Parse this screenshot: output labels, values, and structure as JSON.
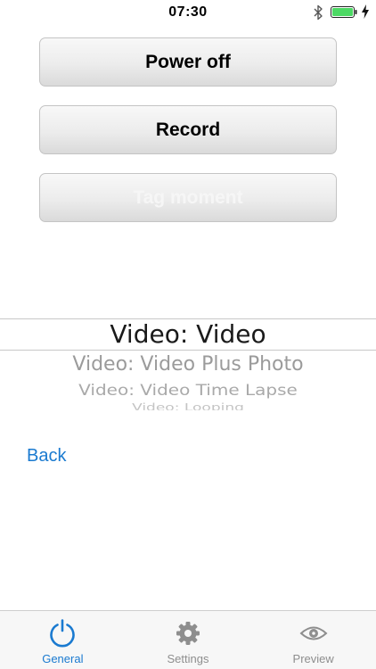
{
  "status_bar": {
    "time": "07:30",
    "battery_color": "#4cd964"
  },
  "buttons": {
    "power_off": "Power off",
    "record": "Record",
    "tag_moment": "Tag moment"
  },
  "picker": {
    "selected": "Video: Video",
    "options": [
      "Video: Video Plus Photo",
      "Video: Video Time Lapse",
      "Video: Looping"
    ]
  },
  "back_label": "Back",
  "tab_bar": {
    "active_color": "#1a7ad0",
    "tabs": [
      {
        "label": "General",
        "icon": "power-icon"
      },
      {
        "label": "Settings",
        "icon": "gear-icon"
      },
      {
        "label": "Preview",
        "icon": "eye-icon"
      }
    ]
  }
}
